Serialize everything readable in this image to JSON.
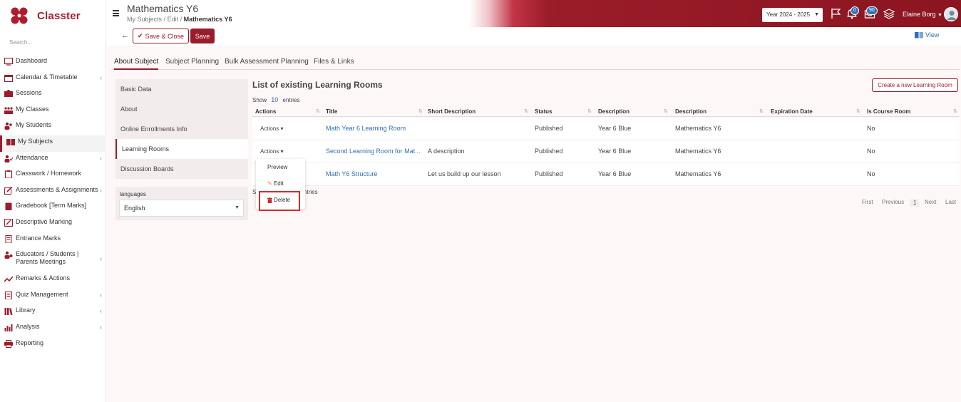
{
  "app": {
    "name": "Classter"
  },
  "sidebar": {
    "search_placeholder": "Search...",
    "items": [
      {
        "label": "Dashboard"
      },
      {
        "label": "Calendar & Timetable"
      },
      {
        "label": "Sessions"
      },
      {
        "label": "My Classes"
      },
      {
        "label": "My Students"
      },
      {
        "label": "My Subjects"
      },
      {
        "label": "Attendance"
      },
      {
        "label": "Classwork / Homework"
      },
      {
        "label": "Assessments & Assignments"
      },
      {
        "label": "Gradebook [Term Marks]"
      },
      {
        "label": "Descriptive Marking"
      },
      {
        "label": "Entrance Marks"
      },
      {
        "label": "Educators / Students | Parents Meetings"
      },
      {
        "label": "Remarks & Actions"
      },
      {
        "label": "Quiz Management"
      },
      {
        "label": "Library"
      },
      {
        "label": "Analysis"
      },
      {
        "label": "Reporting"
      }
    ]
  },
  "header": {
    "title": "Mathematics Y6",
    "breadcrumb": [
      "My Subjects",
      "Edit",
      "Mathematics Y6"
    ],
    "year": "Year 2024 - 2025",
    "notifications_count": "0",
    "messages_count": "90",
    "user_name": "Elaine Borg",
    "brand_color": "#9b1c2a"
  },
  "toolbar": {
    "save_close_label": "Save & Close",
    "save_label": "Save",
    "view_label": "View"
  },
  "tabs": [
    "About Subject",
    "Subject Planning",
    "Bulk Assessment Planning",
    "Files & Links"
  ],
  "subnav": [
    "Basic Data",
    "About",
    "Online Enrollments Info",
    "Learning Rooms",
    "Discussion Boards"
  ],
  "languages": {
    "label": "languages",
    "selected": "English"
  },
  "learning_rooms": {
    "title": "List of existing Learning Rooms",
    "show_prefix": "Show",
    "show_count": "10",
    "show_suffix": "entries",
    "create_button": "Create a new Learning Room",
    "columns": [
      "Actions",
      "Title",
      "Short Description",
      "Status",
      "Description",
      "Description",
      "Expiration Date",
      "Is Course Room"
    ],
    "rows": [
      {
        "actions": "Actions",
        "title": "Math Year 6 Learning Room",
        "short": "",
        "status": "Published",
        "desc1": "Year 6 Blue",
        "desc2": "Mathematics Y6",
        "exp": "",
        "course": "No"
      },
      {
        "actions": "Actions",
        "title": "Second Learning Room for Mat...",
        "short": "A description",
        "status": "Published",
        "desc1": "Year 6 Blue",
        "desc2": "Mathematics Y6",
        "exp": "",
        "course": "No"
      },
      {
        "actions": "Actions",
        "title": "Math Y6 Structure",
        "short": "Let us build up our lesson",
        "status": "Published",
        "desc1": "Year 6 Blue",
        "desc2": "Mathematics Y6",
        "exp": "",
        "course": "No"
      }
    ],
    "showing_prefix": "S",
    "showing_suffix": "entries",
    "pager": [
      "First",
      "Previous",
      "1",
      "Next",
      "Last"
    ]
  },
  "dropdown": {
    "items": [
      "Preview",
      "Edit",
      "Delete"
    ]
  }
}
